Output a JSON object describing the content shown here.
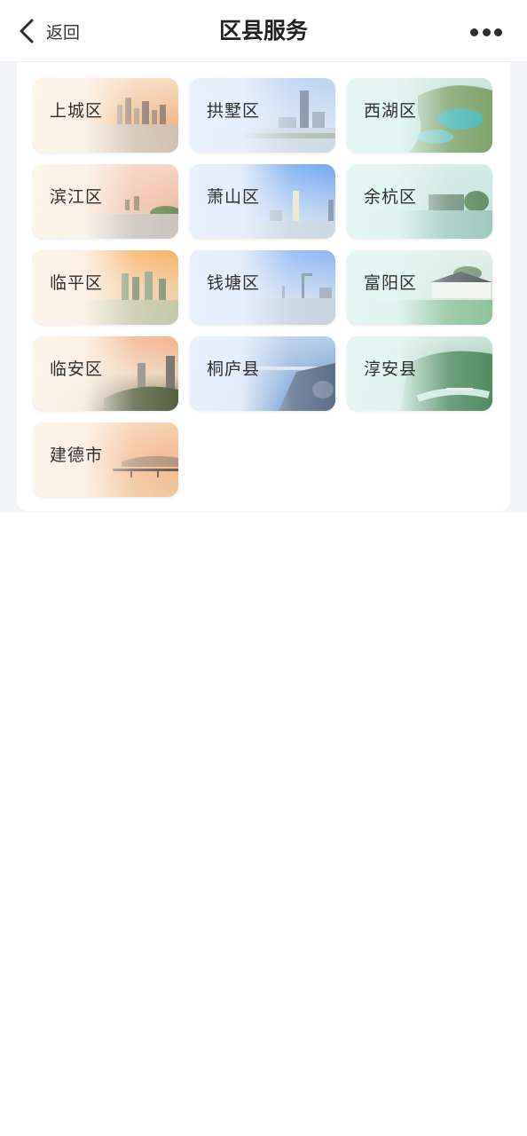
{
  "nav": {
    "back_label": "返回",
    "title": "区县服务"
  },
  "districts": [
    {
      "label": "上城区",
      "theme": "warm"
    },
    {
      "label": "拱墅区",
      "theme": "blue"
    },
    {
      "label": "西湖区",
      "theme": "teal"
    },
    {
      "label": "滨江区",
      "theme": "warm"
    },
    {
      "label": "萧山区",
      "theme": "blue"
    },
    {
      "label": "余杭区",
      "theme": "teal"
    },
    {
      "label": "临平区",
      "theme": "warm"
    },
    {
      "label": "钱塘区",
      "theme": "blue"
    },
    {
      "label": "富阳区",
      "theme": "teal"
    },
    {
      "label": "临安区",
      "theme": "warm"
    },
    {
      "label": "桐庐县",
      "theme": "blue"
    },
    {
      "label": "淳安县",
      "theme": "teal"
    },
    {
      "label": "建德市",
      "theme": "warm"
    }
  ]
}
